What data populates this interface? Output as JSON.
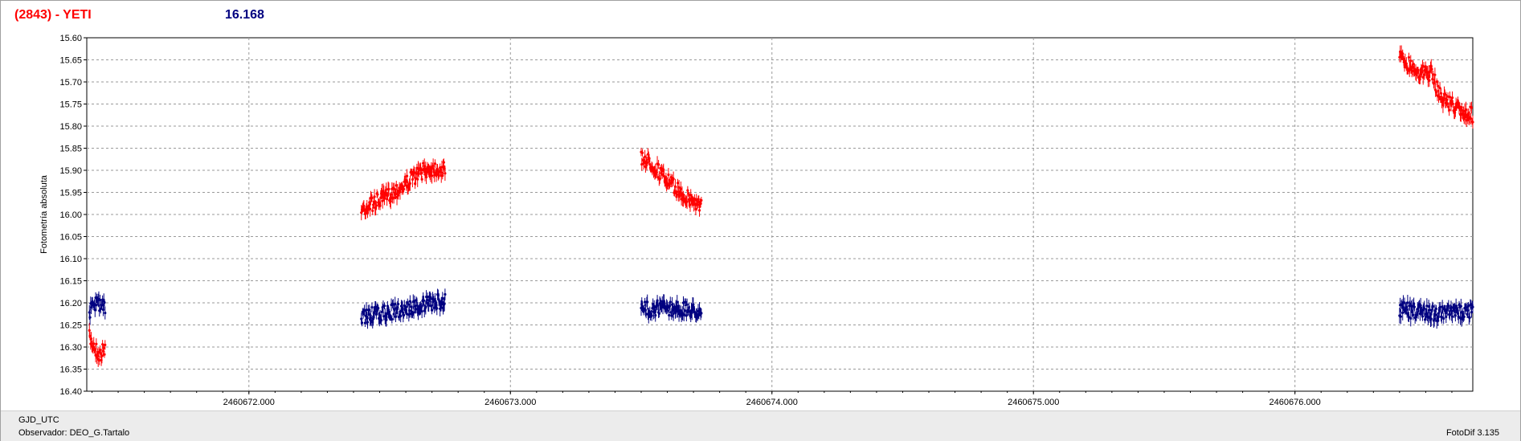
{
  "header": {
    "object": "(2843) - YETI",
    "magnitude": "16.168"
  },
  "footer": {
    "xaxis_name": "GJD_UTC",
    "observer": "Observador: DEO_G.Tartalo",
    "software": "FotoDif 3.135"
  },
  "colors": {
    "target": "#ff0000",
    "comparison": "#000080",
    "grid": "#9a9a9a",
    "axis": "#000000"
  },
  "chart_data": {
    "type": "scatter",
    "ylabel": "Fotometría absoluta",
    "ylim": [
      15.6,
      16.4
    ],
    "y_inverted": true,
    "xlim": [
      2460671.38,
      2460676.68
    ],
    "x_ticks": [
      2460672.0,
      2460673.0,
      2460674.0,
      2460675.0,
      2460676.0
    ],
    "x_tick_labels": [
      "2460672.000",
      "2460673.000",
      "2460674.000",
      "2460675.000",
      "2460676.000"
    ],
    "y_ticks": [
      15.6,
      15.65,
      15.7,
      15.75,
      15.8,
      15.85,
      15.9,
      15.95,
      16.0,
      16.05,
      16.1,
      16.15,
      16.2,
      16.25,
      16.3,
      16.35,
      16.4
    ],
    "y_tick_labels": [
      "15.60",
      "15.65",
      "15.70",
      "15.75",
      "15.80",
      "15.85",
      "15.90",
      "15.95",
      "16.00",
      "16.05",
      "16.10",
      "16.15",
      "16.20",
      "16.25",
      "16.30",
      "16.35",
      "16.40"
    ],
    "grid": true,
    "error_bars": true,
    "series": [
      {
        "color": "#ff0000",
        "segments": [
          {
            "x": [
              2460671.39,
              2460671.4,
              2460671.41,
              2460671.42,
              2460671.43,
              2460671.44,
              2460671.45
            ],
            "y": [
              16.28,
              16.29,
              16.3,
              16.31,
              16.32,
              16.31,
              16.3
            ]
          },
          {
            "x": [
              2460672.43,
              2460672.47,
              2460672.51,
              2460672.55,
              2460672.59,
              2460672.63,
              2460672.67,
              2460672.71,
              2460672.75
            ],
            "y": [
              15.99,
              15.975,
              15.965,
              15.95,
              15.935,
              15.915,
              15.9,
              15.895,
              15.9
            ]
          },
          {
            "x": [
              2460673.5,
              2460673.54,
              2460673.58,
              2460673.62,
              2460673.66,
              2460673.7,
              2460673.73
            ],
            "y": [
              15.87,
              15.885,
              15.91,
              15.935,
              15.955,
              15.97,
              15.98
            ]
          },
          {
            "x": [
              2460676.4,
              2460676.44,
              2460676.48,
              2460676.52,
              2460676.56,
              2460676.6,
              2460676.64,
              2460676.68
            ],
            "y": [
              15.645,
              15.66,
              15.68,
              15.68,
              15.735,
              15.75,
              15.77,
              15.775
            ]
          }
        ]
      },
      {
        "color": "#000080",
        "segments": [
          {
            "x": [
              2460671.39,
              2460671.42,
              2460671.45
            ],
            "y": [
              16.22,
              16.2,
              16.215
            ]
          },
          {
            "x": [
              2460672.43,
              2460672.51,
              2460672.59,
              2460672.67,
              2460672.75
            ],
            "y": [
              16.23,
              16.225,
              16.215,
              16.205,
              16.195
            ]
          },
          {
            "x": [
              2460673.5,
              2460673.58,
              2460673.66,
              2460673.73
            ],
            "y": [
              16.215,
              16.21,
              16.215,
              16.22
            ]
          },
          {
            "x": [
              2460676.4,
              2460676.48,
              2460676.56,
              2460676.64,
              2460676.68
            ],
            "y": [
              16.215,
              16.22,
              16.225,
              16.22,
              16.215
            ]
          }
        ]
      }
    ]
  }
}
